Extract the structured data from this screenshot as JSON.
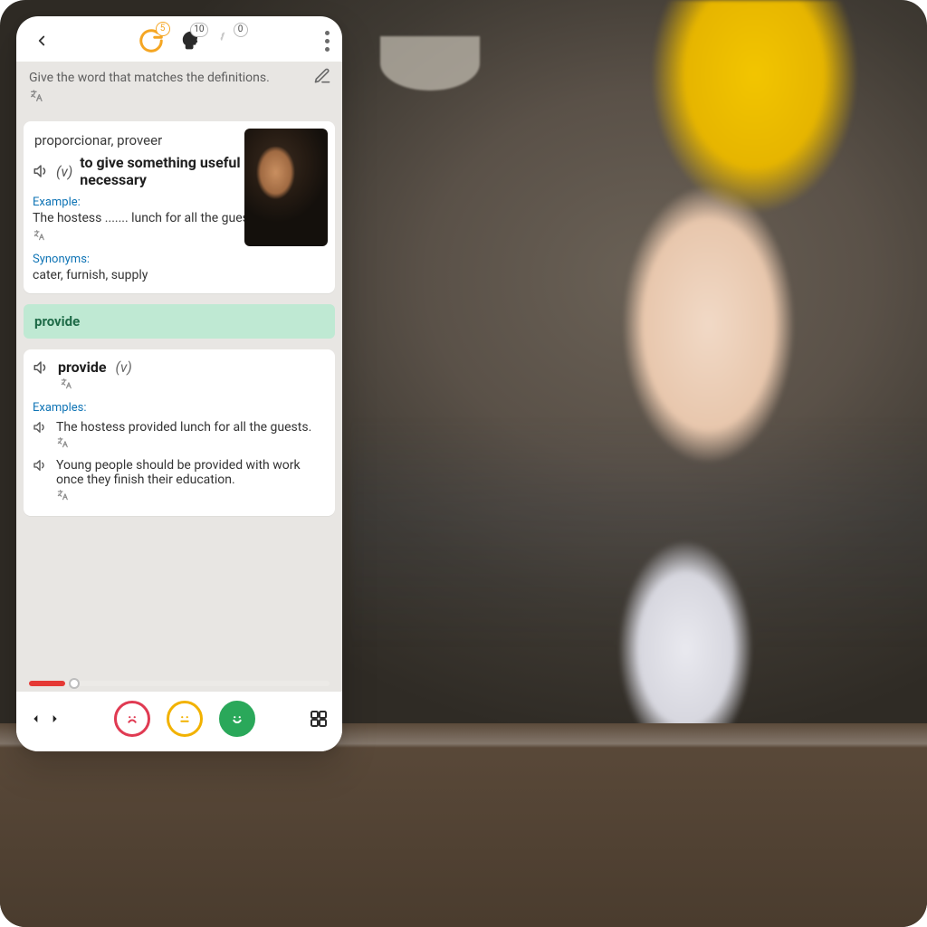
{
  "header": {
    "badges": {
      "refresh": "5",
      "head": "10",
      "brain": "0"
    }
  },
  "instruction": {
    "text": "Give the word that matches the definitions."
  },
  "card": {
    "translation": "proporcionar, proveer",
    "pos": "(v)",
    "definition": "to give something useful or necessary",
    "example_label": "Example:",
    "example_text": "The hostess ....... lunch for all the guests.",
    "synonyms_label": "Synonyms:",
    "synonyms_text": "cater, furnish, supply"
  },
  "answer": {
    "banner": "provide",
    "word": "provide",
    "pos": "(v)",
    "examples_label": "Examples:",
    "examples": [
      "The hostess provided lunch for all the guests.",
      "Young people should be provided with work once they finish their education."
    ]
  },
  "progress": {
    "red_pct": 12,
    "thumb_pct": 15
  },
  "colors": {
    "accent_orange": "#f5a623",
    "answer_green_bg": "#bfe9d3",
    "answer_green_text": "#1f6b48",
    "link_blue": "#0f74b5",
    "sad_red": "#e03a52",
    "neutral_yellow": "#f2b200",
    "happy_green": "#2aa85a",
    "progress_red": "#e53935"
  }
}
